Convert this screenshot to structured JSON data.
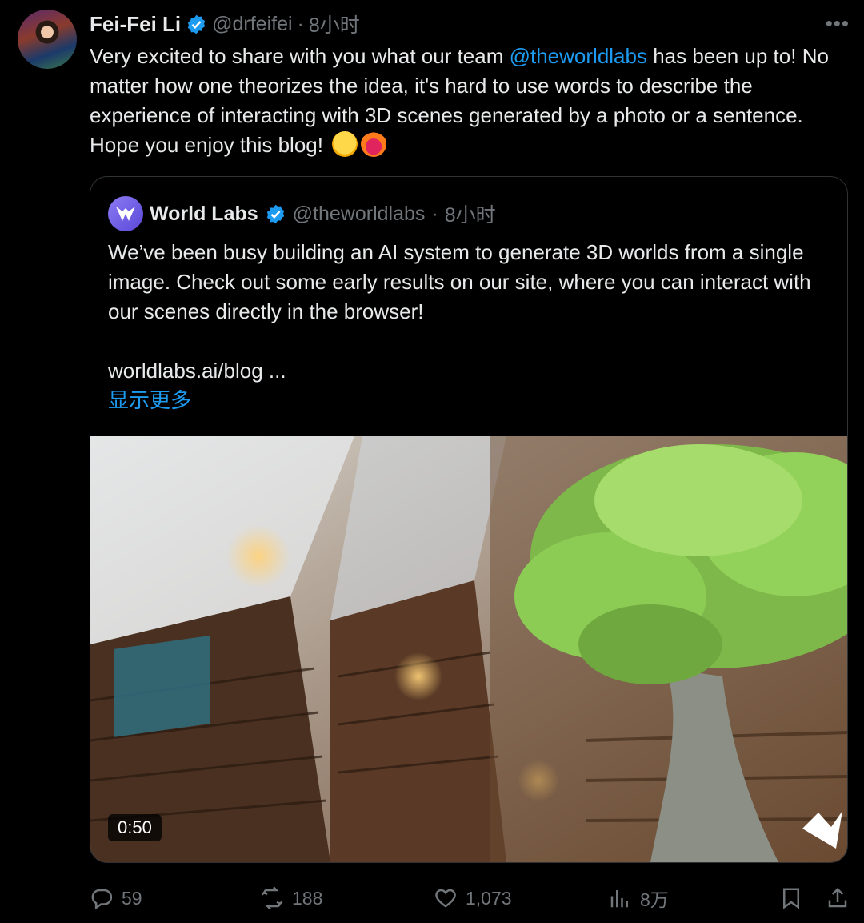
{
  "author": {
    "name": "Fei-Fei Li",
    "handle": "@drfeifei",
    "separator": "·",
    "time": "8小时"
  },
  "tweet": {
    "text_before": "Very excited to share with you what our team ",
    "mention": "@theworldlabs",
    "text_after": " has been up to! No matter how one theorizes the idea, it's hard to use words to describe the experience of interacting with 3D scenes generated by a photo or a sentence. Hope you enjoy this blog! ",
    "emojis": [
      "star-struck",
      "heart-on-fire"
    ]
  },
  "quote": {
    "name": "World Labs",
    "handle": "@theworldlabs",
    "separator": "·",
    "time": "8小时",
    "text": "We’ve been busy building an AI system to generate 3D worlds from a single image. Check out some early results on our site, where you can interact with our scenes directly in the browser!",
    "link": "worldlabs.ai/blog ...",
    "show_more": "显示更多",
    "video_duration": "0:50"
  },
  "actions": {
    "replies": "59",
    "reposts": "188",
    "likes": "1,073",
    "views": "8万"
  },
  "colors": {
    "accent": "#1d9bf0",
    "muted": "#71767b",
    "text": "#e7e9ea",
    "background": "#000000"
  }
}
